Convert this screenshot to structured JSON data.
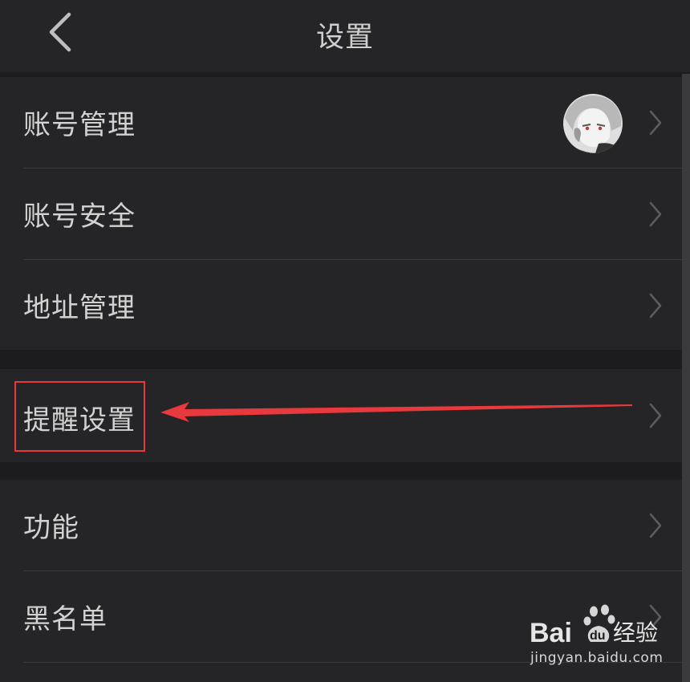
{
  "header": {
    "title": "设置",
    "back_icon": "chevron-left-icon"
  },
  "groups": [
    {
      "items": [
        {
          "label": "账号管理",
          "has_avatar": true
        },
        {
          "label": "账号安全"
        },
        {
          "label": "地址管理"
        }
      ]
    },
    {
      "items": [
        {
          "label": "提醒设置"
        }
      ]
    },
    {
      "items": [
        {
          "label": "功能"
        },
        {
          "label": "黑名单"
        }
      ]
    }
  ],
  "annotation": {
    "highlight_color": "#e8393c"
  },
  "watermark": {
    "brand": "Bai",
    "brand_du": "du",
    "suffix": "经验",
    "url": "jingyan.baidu.com"
  },
  "colors": {
    "background": "#1c1c1e",
    "surface": "#252527",
    "text": "#d2d2d2",
    "chevron": "#5c5c5e",
    "accent": "#e8393c"
  }
}
